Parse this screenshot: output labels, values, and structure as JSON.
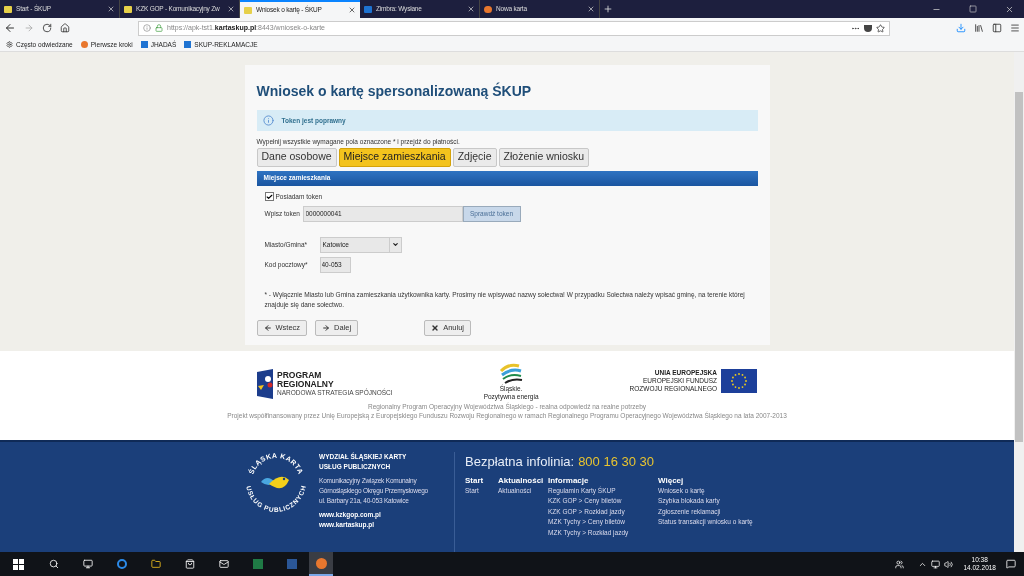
{
  "browser": {
    "tabs": [
      {
        "title": "Start - ŚKUP",
        "selected": false
      },
      {
        "title": "KZK GOP - Komunikacyjny Zw",
        "selected": false
      },
      {
        "title": "Wniosek o kartę - ŚKUP",
        "selected": true
      },
      {
        "title": "Zimbra: Wysłane",
        "selected": false
      },
      {
        "title": "Nowa karta",
        "selected": false
      }
    ],
    "url": "https://apk-tst1.**kartaskup.pl**:8443/wniosek-o-karte",
    "bookmarks": [
      "Często odwiedzane",
      "Pierwsze kroki",
      "JHADAŚ",
      "SKUP-REKLAMACJE"
    ]
  },
  "form": {
    "title": "Wniosek o kartę spersonalizowaną ŚKUP",
    "alert": "Token jest poprawny",
    "instruction": "Wypełnij wszystkie wymagane pola oznaczone * i przejdź do płatności.",
    "steps": [
      {
        "label": "Dane osobowe",
        "selected": false
      },
      {
        "label": "Miejsce zamieszkania",
        "selected": true
      },
      {
        "label": "Zdjęcie",
        "selected": false
      },
      {
        "label": "Złożenie wniosku",
        "selected": false
      }
    ],
    "section_title": "Miejsce zamieszkania",
    "token_checkbox": {
      "label": "Posiadam token",
      "checked": true
    },
    "token_field": {
      "label": "Wpisz token",
      "value": "0000000041"
    },
    "check_button": "Sprawdź token",
    "city": {
      "label": "Miasto/Gmina*",
      "value": "Katowice"
    },
    "postal": {
      "label": "Kod pocztowy*",
      "value": "40-053"
    },
    "note": "* - Wyłącznie Miasto lub Gmina zamieszkania użytkownika karty. Prosimy nie wpisywać nazwy sołectwa! W przypadku Sołectwa należy wpisać gminę, na terenie której znajduje się dane sołectwo.",
    "buttons": [
      {
        "label": "Wstecz",
        "kind": "back"
      },
      {
        "label": "Dalej",
        "kind": "next"
      },
      {
        "label": "Anuluj",
        "kind": "cancel"
      }
    ]
  },
  "sponsors": {
    "program": {
      "line1": "PROGRAM",
      "line2": "REGIONALNY",
      "sub": "NARODOWA STRATEGIA SPÓJNOŚCI"
    },
    "slaskie": {
      "name": "Śląskie.",
      "tagline": "Pozytywna energia"
    },
    "eu": [
      "UNIA EUROPEJSKA",
      "EUROPEJSKI FUNDUSZ",
      "ROZWOJU REGIONALNEGO"
    ],
    "notes": [
      "Regionalny Program Operacyjny Województwa Śląskiego - realna odpowiedź na realne potrzeby",
      "Projekt współfinansowany przez Unię Europejską z Europejskiego Funduszu Rozwoju Regionalnego w ramach Regionalnego Programu Operacyjnego Województwa Śląskiego na lata 2007-2013"
    ]
  },
  "footer": {
    "logo_top": "ŚLĄSKA KARTA",
    "logo_bottom": "USŁUG PUBLICZNYCH",
    "org": [
      "WYDZIAŁ ŚLĄSKIEJ KARTY",
      "USŁUG PUBLICZNYCH"
    ],
    "address": [
      "Komunikacyjny Związek Komunalny",
      "Górnośląskiego Okręgu Przemysłowego",
      "ul. Barbary 21a, 40-053 Katowice"
    ],
    "sites": [
      "www.kzkgop.com.pl",
      "www.kartaskup.pl"
    ],
    "hotline_label": "Bezpłatna infolinia:",
    "hotline_number": "800 16 30 30",
    "columns": [
      {
        "heading": "Start",
        "links": [
          "Start"
        ]
      },
      {
        "heading": "Aktualności",
        "links": [
          "Aktualności"
        ]
      },
      {
        "heading": "Informacje",
        "links": [
          "Regulamin Karty ŚKUP",
          "KZK GOP > Ceny biletów",
          "KZK GOP > Rozkład jazdy",
          "MZK Tychy > Ceny biletów",
          "MZK Tychy > Rozkład jazdy"
        ]
      },
      {
        "heading": "Więcej",
        "links": [
          "Wniosek o kartę",
          "Szybka blokada karty",
          "Zgłoszenie reklamacji",
          "Status transakcji wniosku o kartę"
        ]
      }
    ]
  },
  "taskbar": {
    "time": "10:38",
    "date": "14.02.2018"
  }
}
